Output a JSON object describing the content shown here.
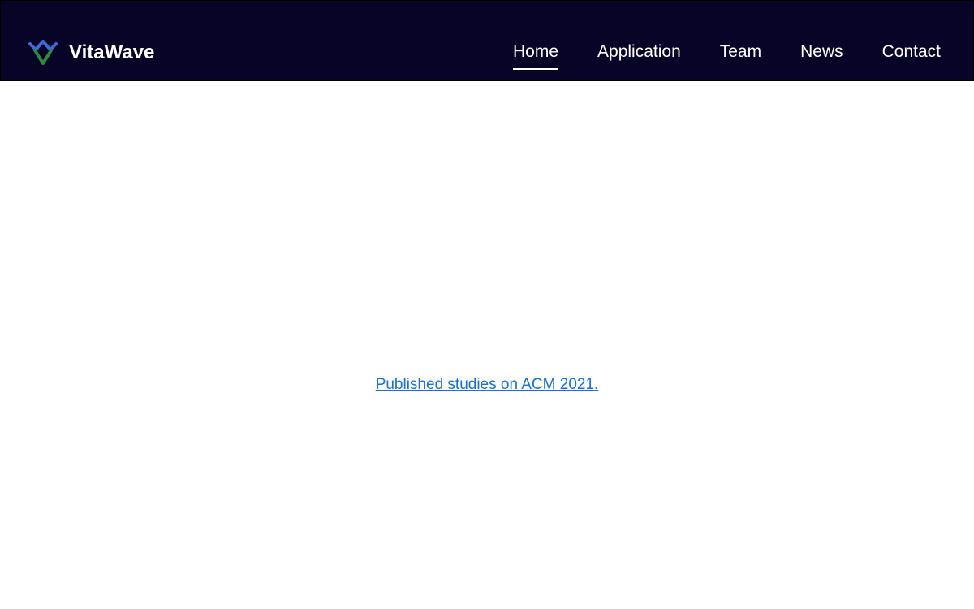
{
  "header": {
    "brand_name": "VitaWave",
    "brand_icon": "vitawave-logo-icon",
    "background_color": "#080428"
  },
  "nav": {
    "items": [
      {
        "label": "Home",
        "active": true
      },
      {
        "label": "Application",
        "active": false
      },
      {
        "label": "Team",
        "active": false
      },
      {
        "label": "News",
        "active": false
      },
      {
        "label": "Contact",
        "active": false
      }
    ]
  },
  "main": {
    "study_link_text": "Published studies on ACM 2021.",
    "link_color": "#1a6fd4"
  },
  "colors": {
    "logo_blue": "#3f6ad8",
    "logo_green": "#2f8a3e"
  }
}
